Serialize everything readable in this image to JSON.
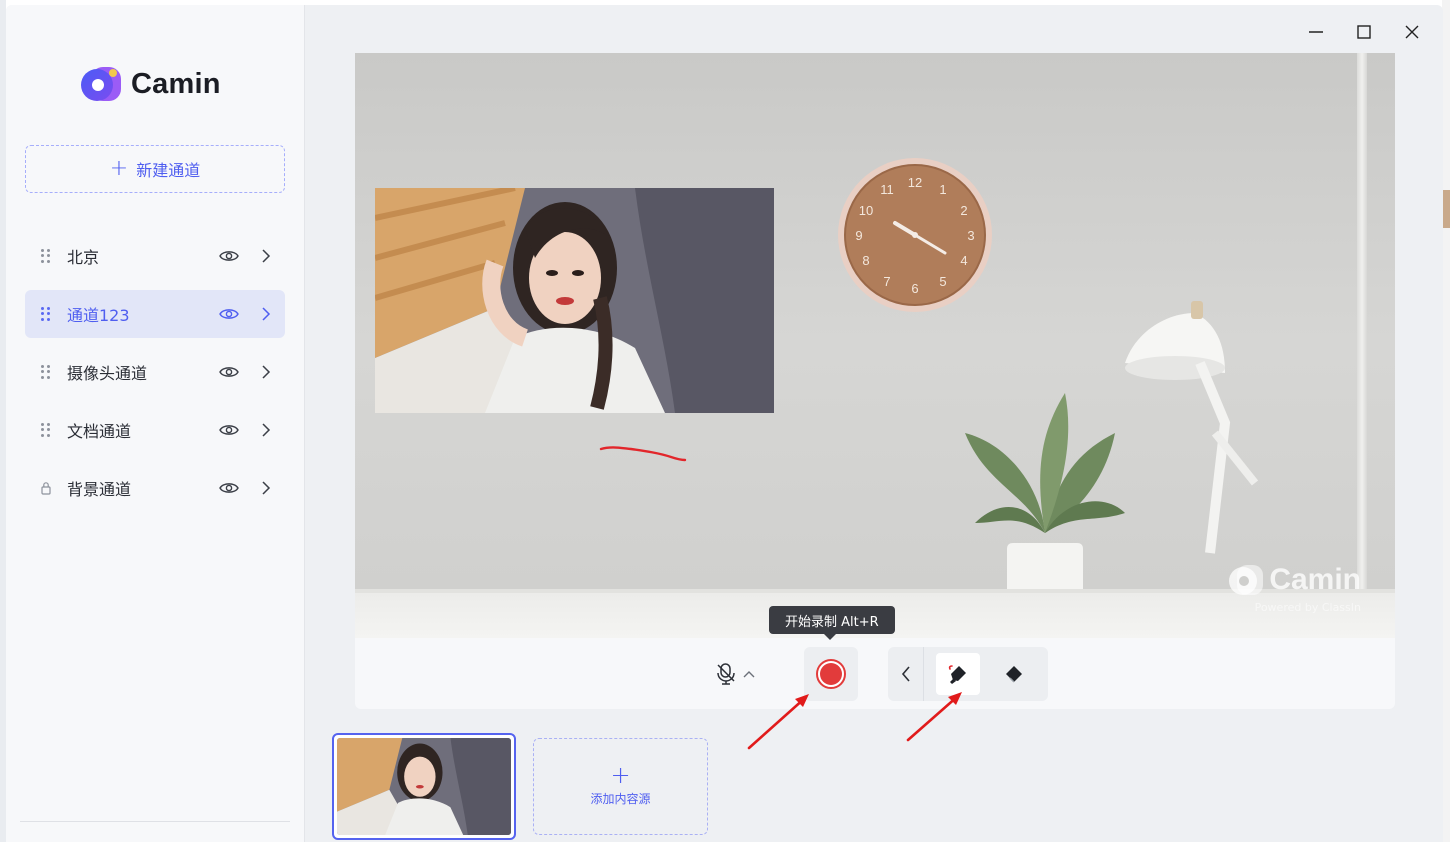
{
  "app": {
    "brand": "Camin",
    "accent_color": "#4f5ef0",
    "record_color": "#e23b3b"
  },
  "window_controls": {
    "minimize_icon": "minimize-icon",
    "maximize_icon": "maximize-icon",
    "close_icon": "close-icon"
  },
  "sidebar": {
    "new_channel_label": "新建通道",
    "channels": [
      {
        "label": "北京",
        "active": false,
        "locked": false
      },
      {
        "label": "通道123",
        "active": true,
        "locked": false
      },
      {
        "label": "摄像头通道",
        "active": false,
        "locked": false
      },
      {
        "label": "文档通道",
        "active": false,
        "locked": false
      },
      {
        "label": "背景通道",
        "active": false,
        "locked": true
      }
    ]
  },
  "preview": {
    "watermark_brand": "Camin",
    "watermark_sub": "Powered by ClassIn"
  },
  "toolbar": {
    "record_tooltip": "开始录制 Alt+R",
    "tools": [
      "mic-icon",
      "record-button",
      "back-icon",
      "pen-icon",
      "eraser-icon"
    ]
  },
  "sources": {
    "add_label": "添加内容源"
  }
}
